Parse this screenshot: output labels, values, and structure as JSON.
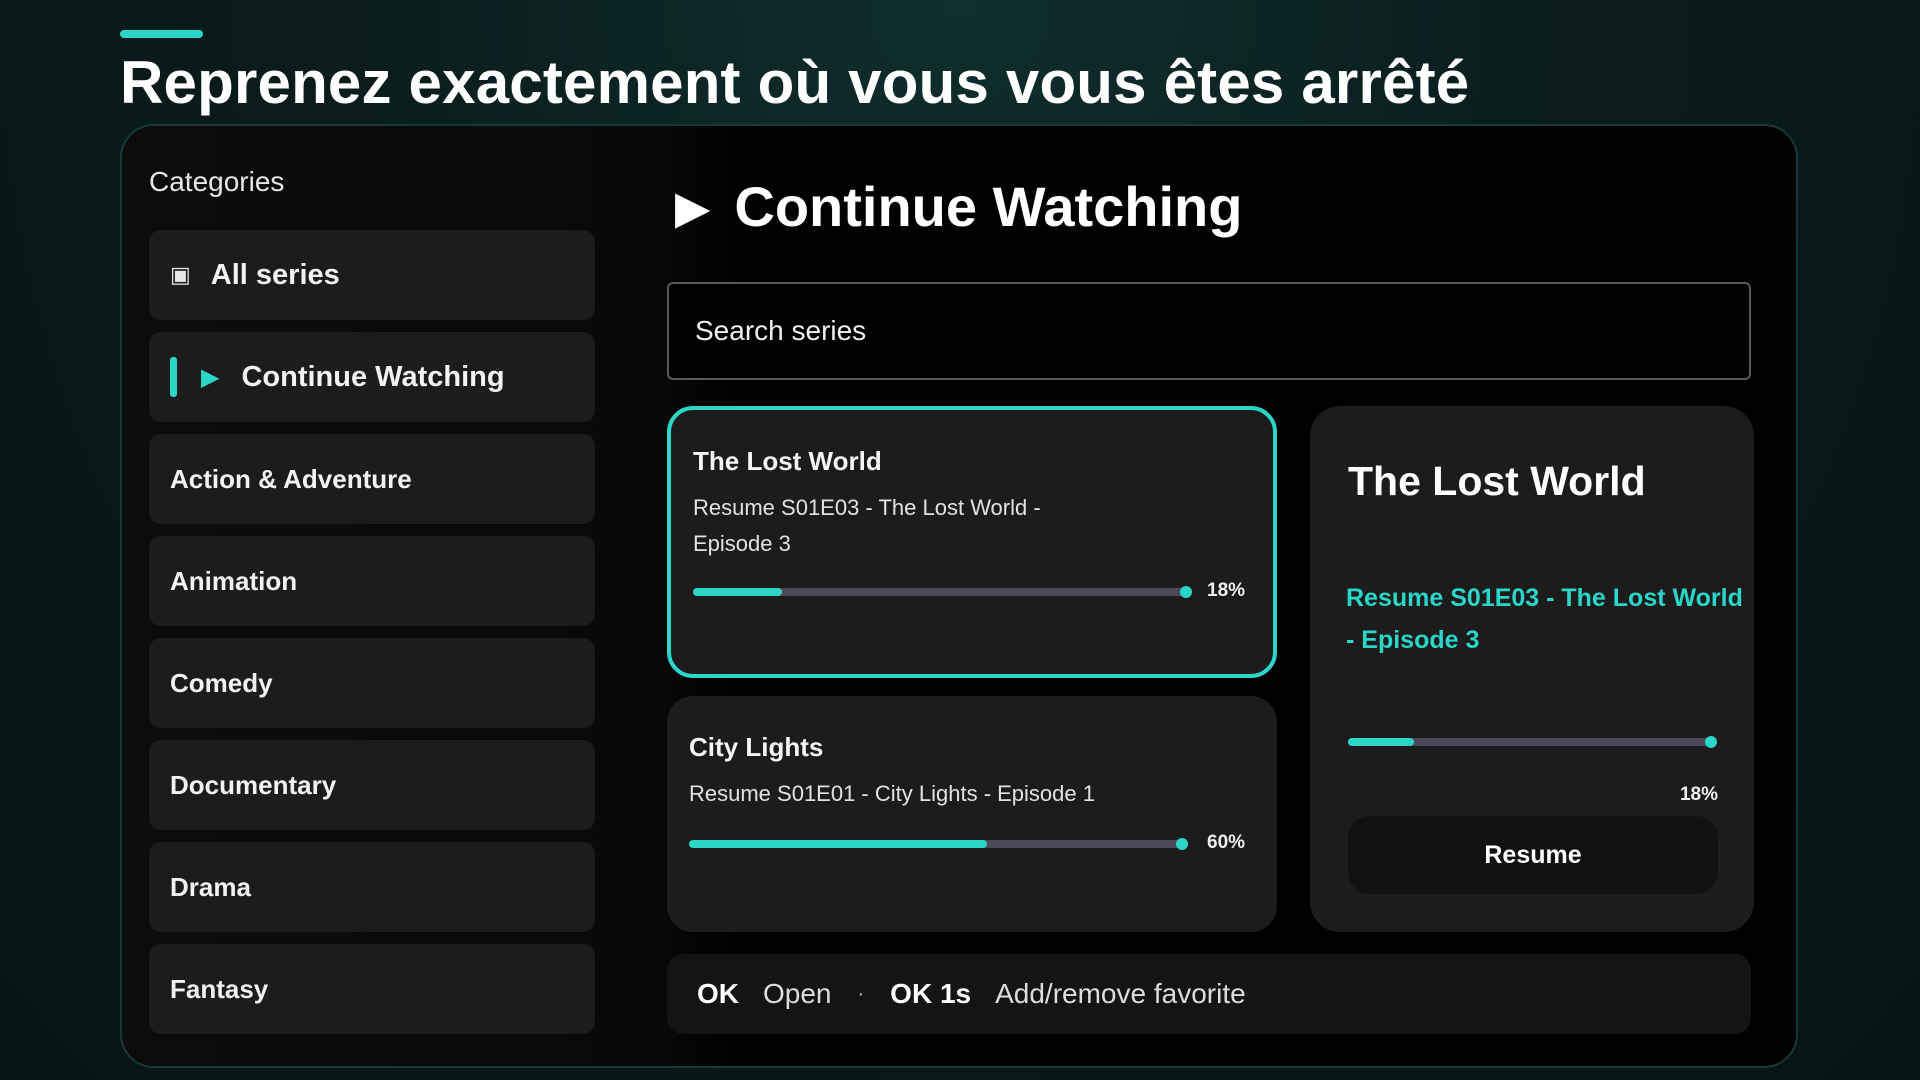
{
  "page": {
    "headline": "Reprenez exactement où vous vous êtes arrêté"
  },
  "sidebar": {
    "title": "Categories",
    "items": [
      {
        "label": "All series",
        "icon": "grid-square-icon",
        "glyph": "▣"
      },
      {
        "label": "Continue Watching",
        "icon": "play-icon",
        "glyph": "▶",
        "active": true
      },
      {
        "label": "Action & Adventure"
      },
      {
        "label": "Animation"
      },
      {
        "label": "Comedy"
      },
      {
        "label": "Documentary"
      },
      {
        "label": "Drama"
      },
      {
        "label": "Fantasy"
      }
    ]
  },
  "main": {
    "title": "Continue Watching",
    "title_icon_glyph": "▶",
    "search": {
      "placeholder": "Search series",
      "value": ""
    },
    "cards": [
      {
        "title": "The Lost World",
        "subtitle": "Resume S01E03 - The Lost World - Episode 3",
        "progress": 0.18,
        "percent_label": "18%",
        "selected": true
      },
      {
        "title": "City Lights",
        "subtitle": "Resume S01E01 - City Lights - Episode 1",
        "progress": 0.6,
        "percent_label": "60%",
        "selected": false
      }
    ],
    "detail": {
      "title": "The Lost World",
      "subtitle": "Resume S01E03 - The Lost World - Episode 3",
      "progress": 0.18,
      "percent_label": "18%",
      "button_label": "Resume"
    },
    "hints": {
      "key1": "OK",
      "action1": "Open",
      "separator": "·",
      "key2": "OK 1s",
      "action2": "Add/remove favorite"
    }
  },
  "colors": {
    "accent": "#2ad6c8",
    "card_bg": "#1c1c1c",
    "panel_bg": "#000000",
    "track": "#4a4a58"
  }
}
